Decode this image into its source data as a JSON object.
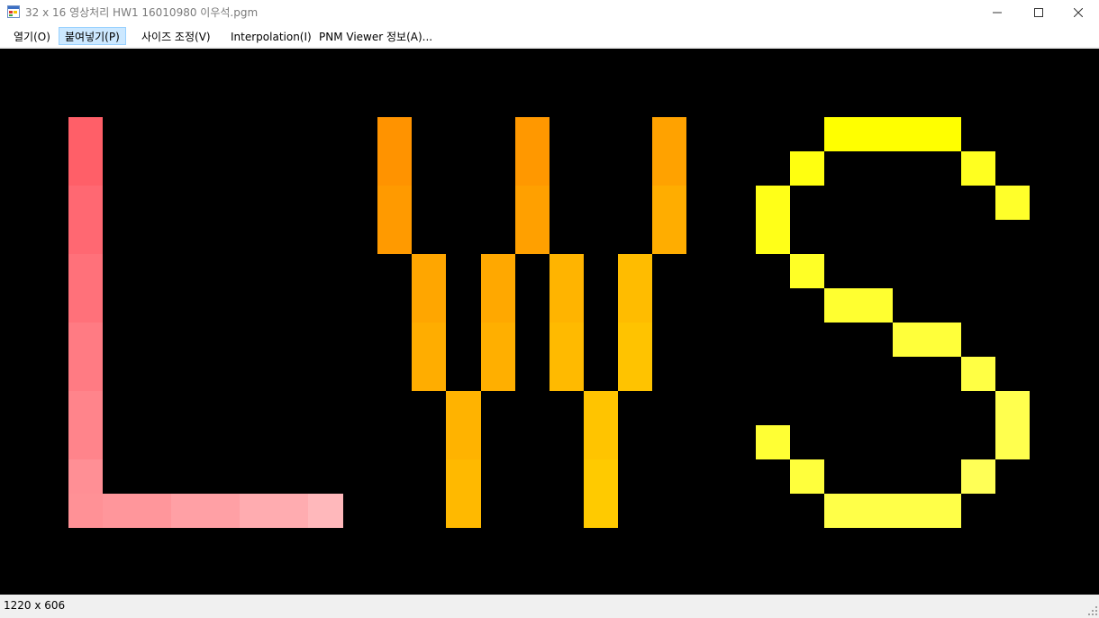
{
  "window": {
    "title": "32 x 16  영상처리 HW1 16010980 이우석.pgm",
    "icon": "app-window-icon",
    "controls": [
      "minimize-icon",
      "maximize-icon",
      "close-icon"
    ]
  },
  "menu": {
    "items": [
      {
        "label": "열기(O)",
        "active": false
      },
      {
        "label": "붙여넣기(P)",
        "active": true
      },
      {
        "label": "사이즈 조정(V)",
        "active": false
      },
      {
        "label": "Interpolation(I)",
        "active": false
      },
      {
        "label": "PNM Viewer 정보(A)...",
        "active": false
      }
    ]
  },
  "image": {
    "background": "#000000",
    "letters": [
      "L",
      "W",
      "S"
    ],
    "colors": {
      "L": "#ff6470",
      "W": "#ff9a00",
      "S": "#ffff00"
    }
  },
  "status": {
    "size_text": "1220 x 606"
  }
}
